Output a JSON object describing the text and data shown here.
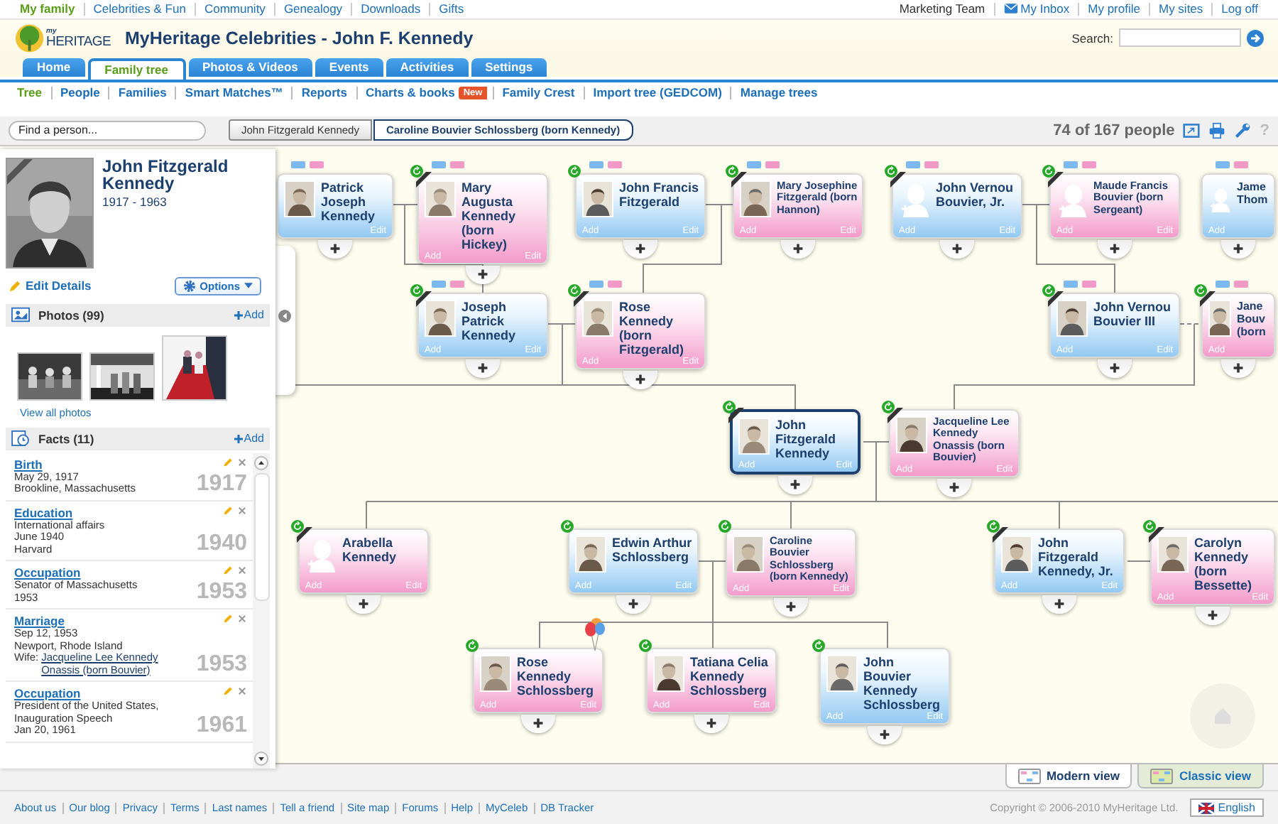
{
  "top_nav": {
    "left": [
      {
        "label": "My family",
        "selected": true
      },
      {
        "label": "Celebrities & Fun",
        "selected": false
      },
      {
        "label": "Community",
        "selected": false
      },
      {
        "label": "Genealogy",
        "selected": false
      },
      {
        "label": "Downloads",
        "selected": false
      },
      {
        "label": "Gifts",
        "selected": false
      }
    ],
    "right": [
      {
        "label": "Marketing Team",
        "kind": "plain"
      },
      {
        "label": "My Inbox",
        "kind": "inbox"
      },
      {
        "label": "My profile",
        "kind": "link"
      },
      {
        "label": "My sites",
        "kind": "link"
      },
      {
        "label": "Log off",
        "kind": "link"
      }
    ]
  },
  "header": {
    "logo": {
      "small": "my",
      "name": "HERITAGE"
    },
    "title": "MyHeritage Celebrities - John F. Kennedy",
    "search": {
      "label": "Search:"
    }
  },
  "tabs": [
    {
      "label": "Home",
      "selected": false
    },
    {
      "label": "Family tree",
      "selected": true
    },
    {
      "label": "Photos & Videos",
      "selected": false
    },
    {
      "label": "Events",
      "selected": false
    },
    {
      "label": "Activities",
      "selected": false
    },
    {
      "label": "Settings",
      "selected": false
    }
  ],
  "subnav": [
    {
      "label": "Tree",
      "selected": true
    },
    {
      "label": "People",
      "selected": false
    },
    {
      "label": "Families",
      "selected": false
    },
    {
      "label": "Smart Matches™",
      "selected": false
    },
    {
      "label": "Reports",
      "selected": false
    },
    {
      "label": "Charts & books",
      "selected": false,
      "badge": "New"
    },
    {
      "label": "Family Crest",
      "selected": false
    },
    {
      "label": "Import tree (GEDCOM)",
      "selected": false
    },
    {
      "label": "Manage trees",
      "selected": false
    }
  ],
  "toolbar": {
    "find_placeholder": "Find a person...",
    "breadcrumbs": [
      {
        "label": "John Fitzgerald Kennedy",
        "selected": false
      },
      {
        "label": "Caroline Bouvier Schlossberg (born Kennedy)",
        "selected": true
      }
    ],
    "count": "74 of 167 people",
    "help": "?"
  },
  "profile": {
    "name": "John Fitzgerald Kennedy",
    "dates": "1917 - 1963",
    "edit": "Edit Details",
    "options": "Options"
  },
  "photos": {
    "title": "Photos (99)",
    "add": "Add",
    "view_all": "View all photos"
  },
  "facts": {
    "title": "Facts (11)",
    "add": "Add",
    "items": [
      {
        "title": "Birth",
        "lines": [
          "May 29, 1917",
          "Brookline, Massachusetts"
        ],
        "year": "1917"
      },
      {
        "title": "Education",
        "lines": [
          "International affairs",
          "June 1940",
          "Harvard"
        ],
        "year": "1940"
      },
      {
        "title": "Occupation",
        "lines": [
          "Senator of Massachusetts",
          "1953"
        ],
        "year": "1953"
      },
      {
        "title": "Marriage",
        "lines": [
          "Sep 12, 1953",
          "Newport, Rhode Island"
        ],
        "spouse_label": "Wife:",
        "spouse": "Jacqueline Lee Kennedy Onassis (born Bouvier)",
        "year": "1953"
      },
      {
        "title": "Occupation",
        "lines": [
          "President of the United States,",
          "Inauguration Speech",
          "Jan 20, 1961"
        ],
        "year": "1961"
      }
    ]
  },
  "tree": {
    "nodes": [
      {
        "name": "Patrick Joseph Kennedy",
        "kind": "male",
        "photo": true,
        "deceased": false,
        "refresh": false,
        "parents_flags": true,
        "selected": false,
        "birthday": false,
        "edit": "Edit"
      },
      {
        "name": "Mary Augusta Kennedy (born Hickey)",
        "kind": "female",
        "photo": true,
        "deceased": true,
        "refresh": true,
        "parents_flags": true,
        "selected": false,
        "birthday": false,
        "add": "Add",
        "edit": "Edit"
      },
      {
        "name": "John Francis Fitzgerald",
        "kind": "male",
        "photo": true,
        "deceased": false,
        "refresh": true,
        "parents_flags": true,
        "selected": false,
        "birthday": false,
        "add": "Add",
        "edit": "Edit"
      },
      {
        "name": "Mary Josephine Fitzgerald (born Hannon)",
        "kind": "female",
        "photo": true,
        "deceased": true,
        "refresh": true,
        "parents_flags": true,
        "selected": false,
        "birthday": false,
        "add": "Add",
        "edit": "Edit"
      },
      {
        "name": "John Vernou Bouvier, Jr.",
        "kind": "male",
        "photo": false,
        "deceased": true,
        "refresh": true,
        "parents_flags": true,
        "selected": false,
        "birthday": false,
        "add": "Add",
        "edit": "Edit"
      },
      {
        "name": "Maude Francis Bouvier (born Sergeant)",
        "kind": "female",
        "photo": false,
        "deceased": true,
        "refresh": true,
        "parents_flags": true,
        "selected": false,
        "birthday": false,
        "add": "Add",
        "edit": "Edit"
      },
      {
        "name": "Jame Thom",
        "kind": "male",
        "photo": false,
        "deceased": false,
        "refresh": false,
        "parents_flags": true,
        "selected": false,
        "birthday": false,
        "add": "Add"
      },
      {
        "name": "Joseph Patrick Kennedy",
        "kind": "male",
        "photo": true,
        "deceased": true,
        "refresh": true,
        "parents_flags": true,
        "selected": false,
        "birthday": false,
        "add": "Add",
        "edit": "Edit"
      },
      {
        "name": "Rose Kennedy (born Fitzgerald)",
        "kind": "female",
        "photo": true,
        "deceased": true,
        "refresh": true,
        "parents_flags": true,
        "selected": false,
        "birthday": false,
        "add": "Add",
        "edit": "Edit"
      },
      {
        "name": "John Vernou Bouvier III",
        "kind": "male",
        "photo": true,
        "deceased": true,
        "refresh": true,
        "parents_flags": true,
        "selected": false,
        "birthday": false,
        "add": "Add",
        "edit": "Edit"
      },
      {
        "name": "Jane Bouv (born",
        "kind": "female",
        "photo": true,
        "deceased": true,
        "refresh": true,
        "parents_flags": true,
        "selected": false,
        "birthday": false,
        "add": "Add"
      },
      {
        "name": "John Fitzgerald Kennedy",
        "kind": "male",
        "photo": true,
        "deceased": true,
        "refresh": true,
        "parents_flags": false,
        "selected": true,
        "birthday": false,
        "add": "Add",
        "edit": "Edit"
      },
      {
        "name": "Jacqueline Lee Kennedy Onassis (born Bouvier)",
        "kind": "female",
        "photo": true,
        "deceased": true,
        "refresh": true,
        "parents_flags": false,
        "selected": false,
        "birthday": false,
        "add": "Add",
        "edit": "Edit"
      },
      {
        "name": "Arabella Kennedy",
        "kind": "female",
        "photo": false,
        "deceased": true,
        "refresh": true,
        "parents_flags": false,
        "selected": false,
        "birthday": false,
        "add": "Add",
        "edit": "Edit"
      },
      {
        "name": "Edwin Arthur Schlossberg",
        "kind": "male",
        "photo": true,
        "deceased": false,
        "refresh": true,
        "parents_flags": false,
        "selected": false,
        "birthday": false,
        "add": "Add",
        "edit": "Edit"
      },
      {
        "name": "Caroline Bouvier Schlossberg (born Kennedy)",
        "kind": "female",
        "photo": true,
        "deceased": false,
        "refresh": true,
        "parents_flags": false,
        "selected": false,
        "birthday": false,
        "add": "Add",
        "edit": "Edit"
      },
      {
        "name": "John Fitzgerald Kennedy, Jr.",
        "kind": "male",
        "photo": true,
        "deceased": true,
        "refresh": true,
        "parents_flags": false,
        "selected": false,
        "birthday": false,
        "add": "Add",
        "edit": "Edit"
      },
      {
        "name": "Carolyn Kennedy (born Bessette)",
        "kind": "female",
        "photo": true,
        "deceased": true,
        "refresh": true,
        "parents_flags": false,
        "selected": false,
        "birthday": false,
        "add": "Add",
        "edit": "Edit"
      },
      {
        "name": "Rose Kennedy Schlossberg",
        "kind": "female",
        "photo": true,
        "deceased": false,
        "refresh": true,
        "parents_flags": false,
        "selected": false,
        "birthday": true,
        "add": "Add",
        "edit": "Edit"
      },
      {
        "name": "Tatiana Celia Kennedy Schlossberg",
        "kind": "female",
        "photo": true,
        "deceased": false,
        "refresh": true,
        "parents_flags": false,
        "selected": false,
        "birthday": false,
        "add": "Add",
        "edit": "Edit"
      },
      {
        "name": "John Bouvier Kennedy Schlossberg",
        "kind": "male",
        "photo": true,
        "deceased": false,
        "refresh": true,
        "parents_flags": false,
        "selected": false,
        "birthday": false,
        "add": "Add",
        "edit": "Edit"
      }
    ]
  },
  "view_switch": [
    {
      "label": "Modern view",
      "selected": true
    },
    {
      "label": "Classic view",
      "selected": false
    }
  ],
  "footer": {
    "links": [
      "About us",
      "Our blog",
      "Privacy",
      "Terms",
      "Last names",
      "Tell a friend",
      "Site map",
      "Forums",
      "Help",
      "MyCeleb",
      "DB Tracker"
    ],
    "copyright": "Copyright © 2006-2010 MyHeritage Ltd.",
    "language": "English"
  }
}
